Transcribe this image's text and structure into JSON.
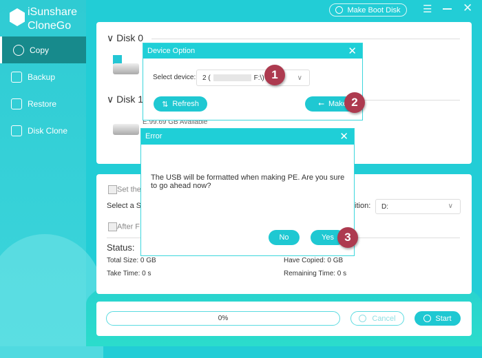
{
  "app": {
    "name_line1": "iSunshare",
    "name_line2": "CloneGo"
  },
  "sidebar": {
    "items": [
      {
        "label": "Copy",
        "icon": "sync-icon",
        "selected": true
      },
      {
        "label": "Backup",
        "icon": "backup-icon"
      },
      {
        "label": "Restore",
        "icon": "restore-icon"
      },
      {
        "label": "Disk Clone",
        "icon": "disk-clone-icon"
      }
    ]
  },
  "topbar": {
    "make_boot_disk": "Make Boot Disk"
  },
  "disks": {
    "disk0": "Disk 0",
    "disk1": "Disk 1",
    "disk1_info": "E:99.69 GB Available"
  },
  "options": {
    "set_the": "Set the",
    "select_a": "Select a S",
    "partition_label": "tition:",
    "partition_value": "D:",
    "after": "After F"
  },
  "status": {
    "title": "Status:",
    "total_size": "Total Size: 0 GB",
    "take_time": "Take Time: 0 s",
    "have_copied": "Have Copied: 0 GB",
    "remaining_time": "Remaining Time: 0 s"
  },
  "progress": {
    "value": 0,
    "label": "0%"
  },
  "buttons": {
    "cancel": "Cancel",
    "start": "Start"
  },
  "device_dialog": {
    "title": "Device Option",
    "select_label": "Select device:",
    "device_value_prefix": "2 (",
    "device_value_suffix": "F:\\)",
    "refresh": "Refresh",
    "make": "Make"
  },
  "error_dialog": {
    "title": "Error",
    "message": "The USB will be formatted when making PE. Are you sure to go ahead now?",
    "no": "No",
    "yes": "Yes"
  },
  "badges": [
    "1",
    "2",
    "3"
  ],
  "colors": {
    "accent": "#1fcfd7",
    "badge": "#ad3a4f",
    "selected_nav": "#178a8c"
  }
}
